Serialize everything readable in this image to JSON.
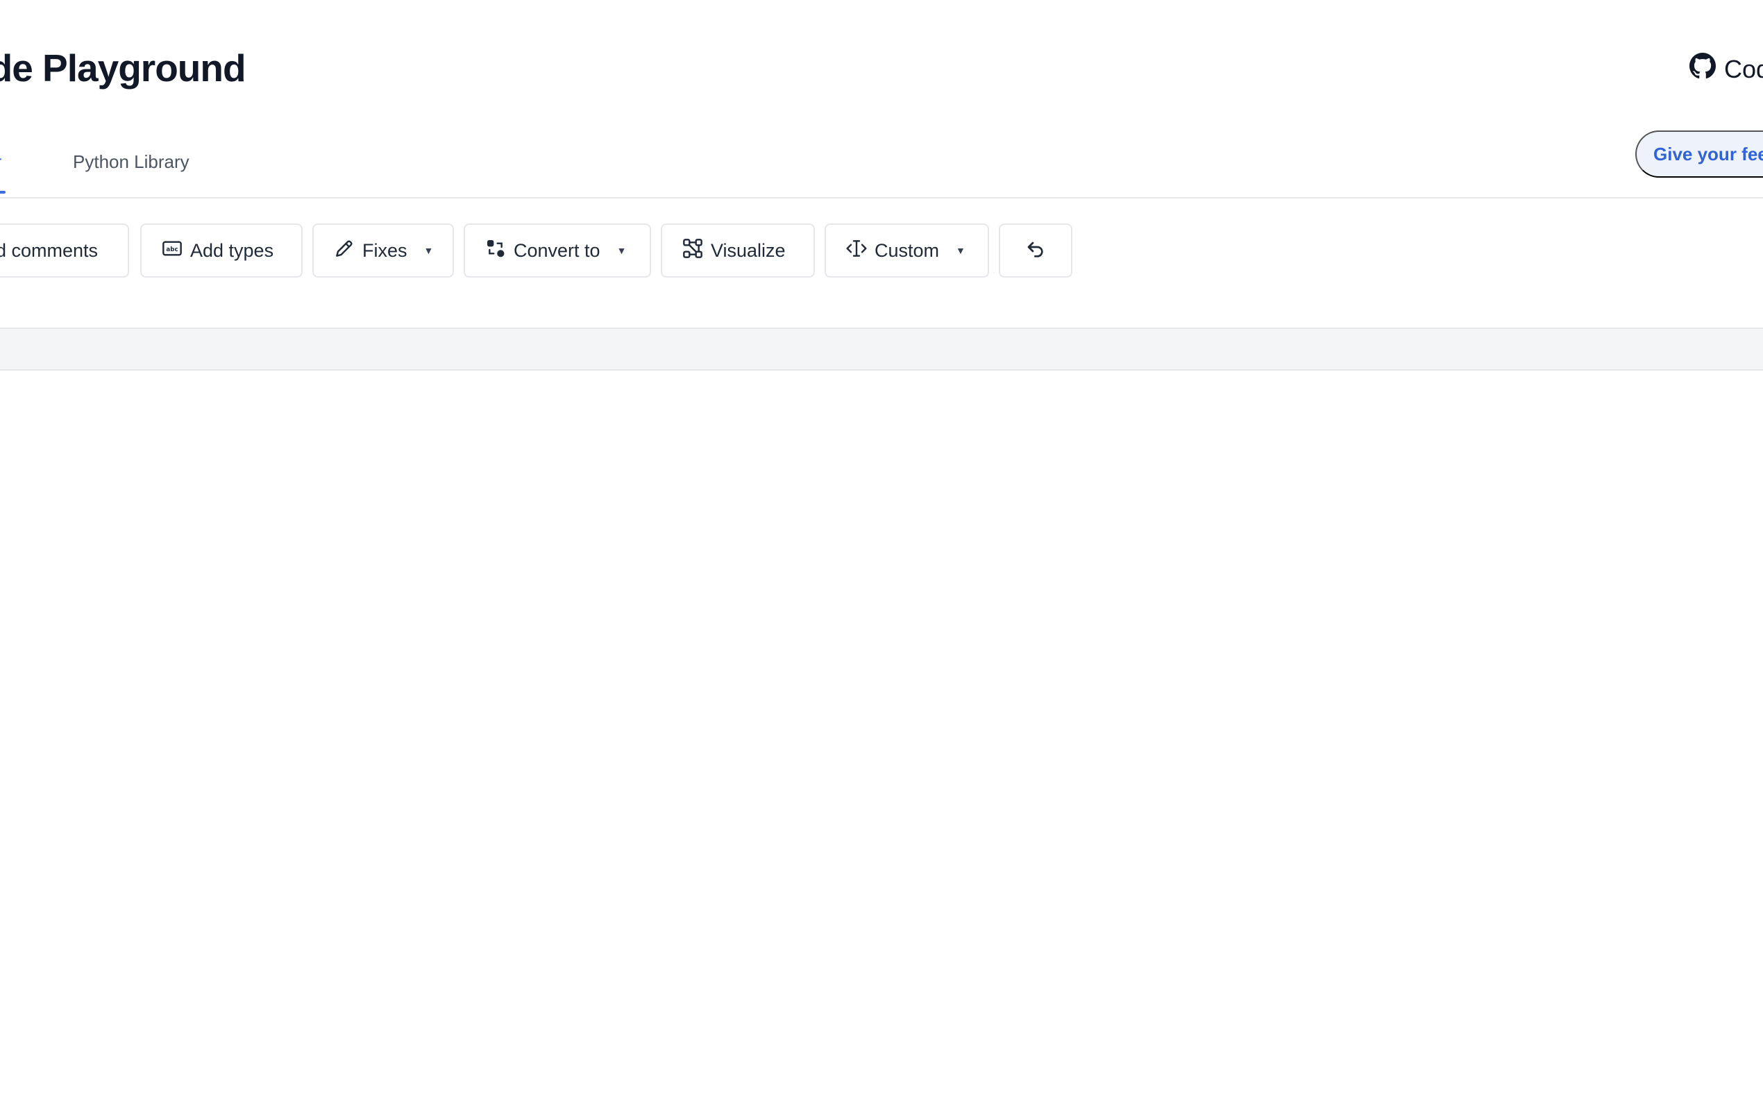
{
  "header": {
    "title": "ode Playground",
    "github_label": "Cod"
  },
  "tabs": [
    {
      "label": "tor",
      "active": true
    },
    {
      "label": "Python Library",
      "active": false
    }
  ],
  "feedback": {
    "label": "Give your fee"
  },
  "toolbar": {
    "comments_label": "d comments",
    "types_label": "Add types",
    "fixes_label": "Fixes",
    "convert_label": "Convert to",
    "visualize_label": "Visualize",
    "custom_label": "Custom",
    "caret": "▼"
  },
  "colors": {
    "accent": "#3b6fe0",
    "text": "#111827",
    "border": "#e5e7eb",
    "feedback_bg": "#eef2fb"
  }
}
